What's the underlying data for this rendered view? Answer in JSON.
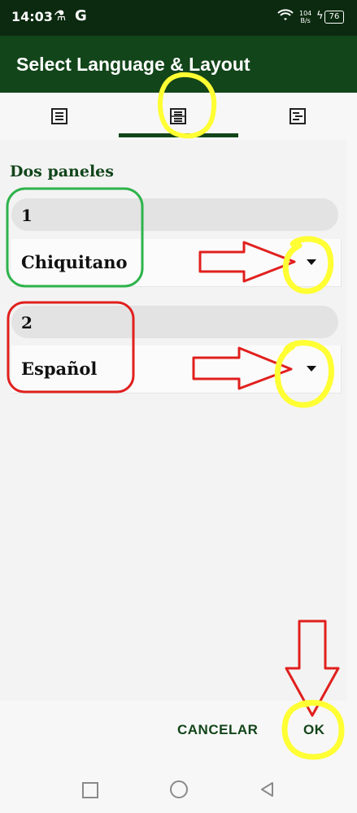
{
  "status_bar": {
    "time": "14:03",
    "app_icon_g": "G",
    "net_speed_value": "104",
    "net_speed_unit": "B/s",
    "battery": "76"
  },
  "dialog": {
    "title": "Select Language & Layout"
  },
  "tabs": [
    {
      "icon": "single-pane-layout-icon",
      "selected": false
    },
    {
      "icon": "two-pane-layout-icon",
      "selected": true
    },
    {
      "icon": "interlinear-layout-icon",
      "selected": false
    }
  ],
  "layout": {
    "name": "Dos paneles"
  },
  "panes": [
    {
      "number": "1",
      "language": "Chiquitano"
    },
    {
      "number": "2",
      "language": "Español"
    }
  ],
  "buttons": {
    "cancel": "CANCELAR",
    "ok": "OK"
  },
  "colors": {
    "app_bar": "#12451a",
    "status_bar": "#0b2a0f",
    "accent_text": "#12451a",
    "annotation_yellow": "#ffff33",
    "annotation_red": "#e0201e",
    "annotation_green": "#2db34a"
  }
}
